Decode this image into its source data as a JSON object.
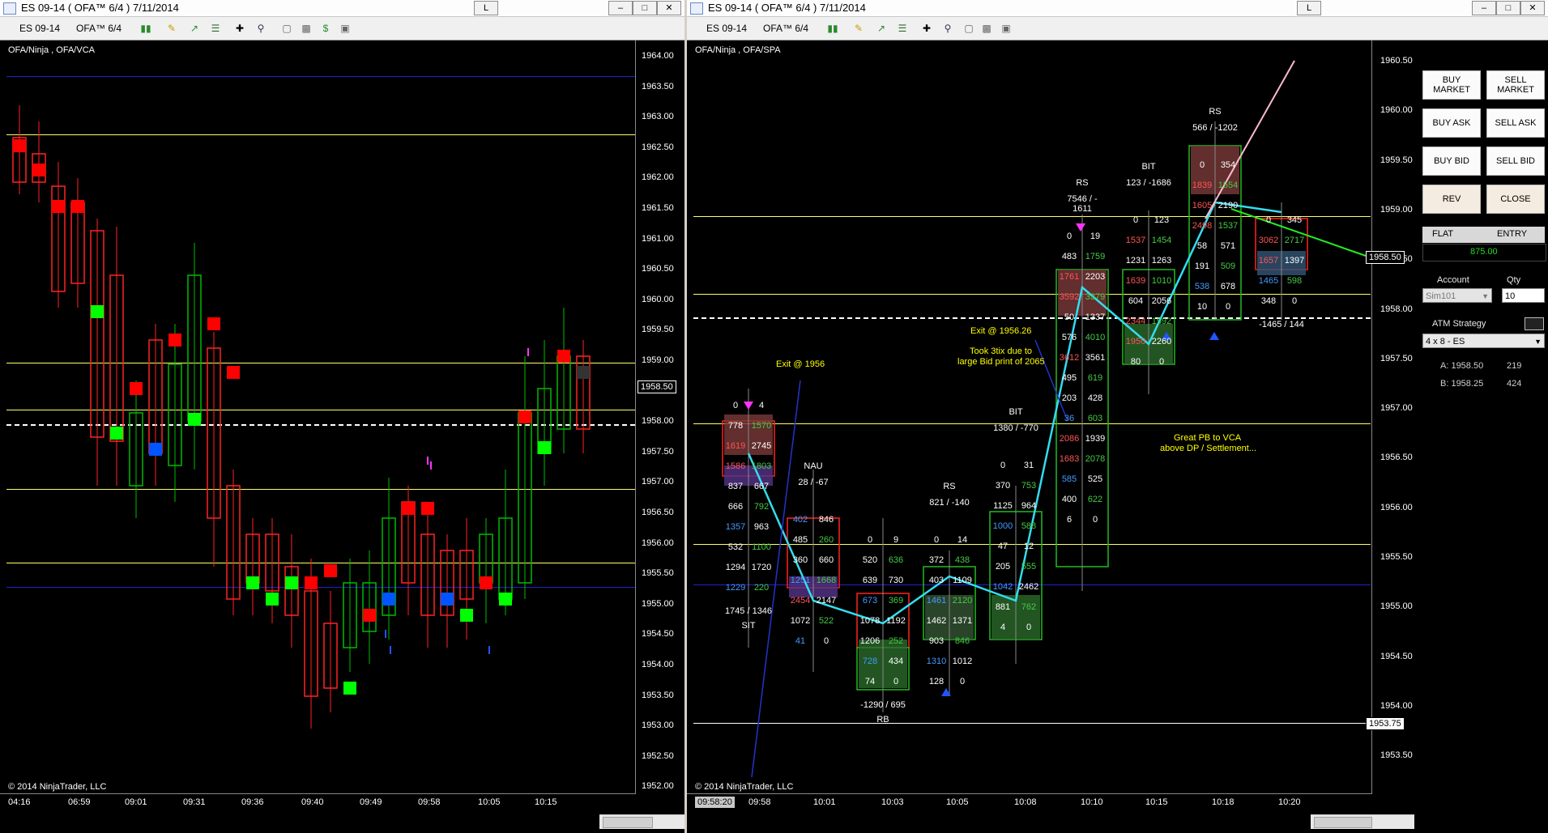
{
  "left_window": {
    "title": "ES 09-14 ( OFA™ 6/4 )  7/11/2014",
    "btn_l": "L",
    "toolbar": {
      "instrument": "ES 09-14",
      "period": "OFA™ 6/4"
    },
    "chart_title": "OFA/Ninja , OFA/VCA",
    "copyright": "© 2014 NinjaTrader, LLC",
    "y_labels": [
      "1964.00",
      "1963.50",
      "1963.00",
      "1962.50",
      "1962.00",
      "1961.50",
      "1961.00",
      "1960.50",
      "1960.00",
      "1959.50",
      "1959.00",
      "1958.50",
      "1958.00",
      "1957.50",
      "1957.00",
      "1956.50",
      "1956.00",
      "1955.50",
      "1955.00",
      "1954.50",
      "1954.00",
      "1953.50",
      "1953.00",
      "1952.50",
      "1952.00"
    ],
    "x_labels": [
      "04:16",
      "06:59",
      "09:01",
      "09:31",
      "09:36",
      "09:40",
      "09:49",
      "09:58",
      "10:05",
      "10:15"
    ],
    "price_box": "1958.50"
  },
  "right_window": {
    "title": "ES 09-14 ( OFA™ 6/4 )  7/11/2014",
    "btn_l": "L",
    "toolbar": {
      "instrument": "ES 09-14",
      "period": "OFA™ 6/4"
    },
    "chart_title": "OFA/Ninja , OFA/SPA",
    "copyright": "© 2014 NinjaTrader, LLC",
    "time_box": "09:58:20",
    "y_labels": [
      "1960.50",
      "1960.00",
      "1959.50",
      "1959.00",
      "1958.50",
      "1958.00",
      "1957.50",
      "1957.00",
      "1956.50",
      "1956.00",
      "1955.50",
      "1955.00",
      "1954.50",
      "1954.00",
      "1953.50"
    ],
    "x_labels": [
      "09:58",
      "10:01",
      "10:03",
      "10:05",
      "10:08",
      "10:10",
      "10:15",
      "10:18",
      "10:20"
    ],
    "price_box_current": "1958.50",
    "price_box_white": "1953.75",
    "annotations": {
      "exit1": "Exit @ 1956",
      "exit2": "Exit @ 1956.26",
      "took1": "Took 3tix due to",
      "took2": "large Bid print of 2065",
      "pb1": "Great PB to VCA",
      "pb2": "above DP / Settlement..."
    },
    "bars": [
      {
        "top_label": "",
        "stat": "",
        "bottom_stat": "1745 / 1346",
        "bottom_label": "SIT",
        "rows": [
          [
            "0",
            "4"
          ],
          [
            "778",
            "1570"
          ],
          [
            "1619",
            "2745"
          ],
          [
            "1586",
            "1803"
          ],
          [
            "837",
            "667"
          ],
          [
            "666",
            "792"
          ],
          [
            "1357",
            "963"
          ],
          [
            "532",
            "1100"
          ],
          [
            "1294",
            "1720"
          ],
          [
            "1229",
            "220"
          ]
        ]
      },
      {
        "top_label": "NAU",
        "stat": "28 / -67",
        "bottom_stat": "",
        "bottom_label": "",
        "rows": [
          [
            "402",
            "846"
          ],
          [
            "485",
            "260"
          ],
          [
            "360",
            "660"
          ],
          [
            "1251",
            "1668"
          ],
          [
            "2454",
            "2147"
          ],
          [
            "1072",
            "522"
          ],
          [
            "41",
            "0"
          ]
        ]
      },
      {
        "top_label": "",
        "stat": "",
        "bottom_stat": "-1290 / 695",
        "bottom_label": "RB",
        "rows": [
          [
            "0",
            "9"
          ],
          [
            "520",
            "636"
          ],
          [
            "639",
            "730"
          ],
          [
            "673",
            "369"
          ],
          [
            "1078",
            "1192"
          ],
          [
            "1206",
            "252"
          ],
          [
            "728",
            "434"
          ],
          [
            "74",
            "0"
          ]
        ]
      },
      {
        "top_label": "RS",
        "stat": "821 / -140",
        "bottom_stat": "",
        "bottom_label": "",
        "rows": [
          [
            "0",
            "14"
          ],
          [
            "372",
            "438"
          ],
          [
            "403",
            "1109"
          ],
          [
            "1461",
            "2120"
          ],
          [
            "1462",
            "1371"
          ],
          [
            "903",
            "846"
          ],
          [
            "1310",
            "1012"
          ],
          [
            "128",
            "0"
          ]
        ]
      },
      {
        "top_label": "BIT",
        "stat": "1380 / -770",
        "bottom_stat": "",
        "bottom_label": "",
        "rows": [
          [
            "0",
            "31"
          ],
          [
            "370",
            "753"
          ],
          [
            "1125",
            "964"
          ],
          [
            "1000",
            "588"
          ],
          [
            "47",
            "12"
          ],
          [
            "205",
            "555"
          ],
          [
            "1042",
            "2462"
          ],
          [
            "881",
            "762"
          ],
          [
            "4",
            "0"
          ]
        ]
      },
      {
        "top_label": "RS",
        "stat": "7546 / -",
        "stat2": "1611",
        "bottom_stat": "",
        "bottom_label": "",
        "rows": [
          [
            "0",
            "19"
          ],
          [
            "483",
            "1759"
          ],
          [
            "1761",
            "2203"
          ],
          [
            "3592",
            "3379"
          ],
          [
            "50",
            "1337"
          ],
          [
            "576",
            "4010"
          ],
          [
            "3612",
            "3561"
          ],
          [
            "495",
            "619"
          ],
          [
            "203",
            "428"
          ],
          [
            "36",
            "603"
          ],
          [
            "2086",
            "1939"
          ],
          [
            "1683",
            "2078"
          ],
          [
            "585",
            "525"
          ],
          [
            "400",
            "622"
          ],
          [
            "6",
            "0"
          ]
        ]
      },
      {
        "top_label": "BIT",
        "stat": "123 / -1686",
        "bottom_stat": "",
        "bottom_label": "",
        "rows": [
          [
            "0",
            "123"
          ],
          [
            "1537",
            "1454"
          ],
          [
            "1231",
            "1263"
          ],
          [
            "1639",
            "1010"
          ],
          [
            "604",
            "2056"
          ],
          [
            "2344",
            "1592"
          ],
          [
            "1950",
            "2260"
          ],
          [
            "80",
            "0"
          ]
        ]
      },
      {
        "top_label": "RS",
        "stat": "566 / -1202",
        "bottom_stat": "",
        "bottom_label": "",
        "rows": [
          [
            "0",
            "354"
          ],
          [
            "1839",
            "1554"
          ],
          [
            "1605",
            "2190"
          ],
          [
            "2498",
            "1537"
          ],
          [
            "58",
            "571"
          ],
          [
            "191",
            "509"
          ],
          [
            "538",
            "678"
          ],
          [
            "10",
            "0"
          ]
        ]
      },
      {
        "top_label": "",
        "stat": "",
        "bottom_stat": "-1465 / 144",
        "bottom_label": "",
        "rows": [
          [
            "0",
            "345"
          ],
          [
            "3062",
            "2717"
          ],
          [
            "1657",
            "1397"
          ],
          [
            "1465",
            "598"
          ],
          [
            "348",
            "0"
          ]
        ]
      }
    ]
  },
  "order_panel": {
    "buy_market": "BUY MARKET",
    "sell_market": "SELL MARKET",
    "buy_ask": "BUY ASK",
    "sell_ask": "SELL ASK",
    "buy_bid": "BUY BID",
    "sell_bid": "SELL BID",
    "rev": "REV",
    "close": "CLOSE",
    "flat": "FLAT",
    "entry": "ENTRY",
    "pnl": "875.00",
    "account_label": "Account",
    "account_value": "Sim101",
    "qty_label": "Qty",
    "qty_value": "10",
    "atm_label": "ATM Strategy",
    "atm_value": "4 x 8 - ES",
    "ask_line": "A:  1958.50",
    "ask_size": "219",
    "bid_line": "B:  1958.25",
    "bid_size": "424"
  },
  "colors": {
    "up": "#00ff00",
    "down": "#ff0000",
    "yellow_line": "#ffff66",
    "blue_line": "#2222cc",
    "cyan_path": "#33ddee"
  }
}
